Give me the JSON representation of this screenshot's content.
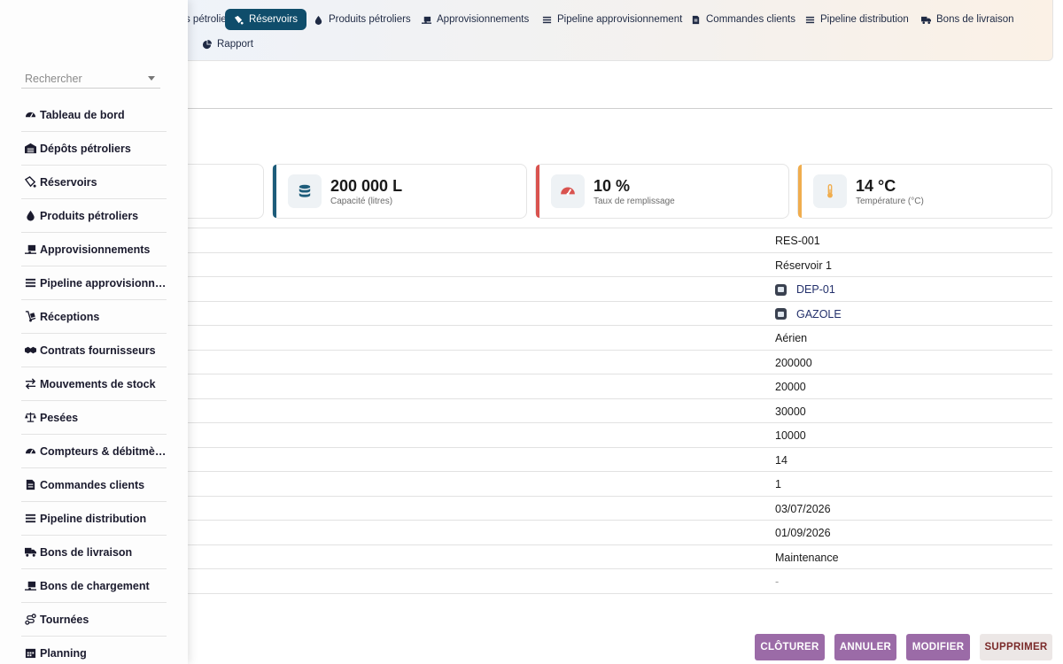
{
  "topnav": {
    "items": [
      {
        "label": "pôts pétroliers",
        "icon": "warehouse-icon"
      },
      {
        "label": "Réservoirs",
        "icon": "gas-pump-icon",
        "active": true
      },
      {
        "label": "Produits pétroliers",
        "icon": "droplet-icon"
      },
      {
        "label": "Approvisionnements",
        "icon": "truck-ramp-icon"
      },
      {
        "label": "Pipeline approvisionnement",
        "icon": "bars-icon"
      },
      {
        "label": "Commandes clients",
        "icon": "file-lines-icon"
      },
      {
        "label": "Pipeline distribution",
        "icon": "bars-icon"
      },
      {
        "label": "Bons de livraison",
        "icon": "truck-icon"
      },
      {
        "label": "Rapport",
        "icon": "chart-pie-icon"
      }
    ]
  },
  "sidebar": {
    "search_placeholder": "Rechercher",
    "items": [
      {
        "label": "Tableau de bord",
        "icon": "gauge-icon"
      },
      {
        "label": "Dépôts pétroliers",
        "icon": "warehouse-icon"
      },
      {
        "label": "Réservoirs",
        "icon": "gas-pump-icon"
      },
      {
        "label": "Produits pétroliers",
        "icon": "droplet-icon"
      },
      {
        "label": "Approvisionnements",
        "icon": "truck-ramp-icon"
      },
      {
        "label": "Pipeline approvisionnement",
        "icon": "bars-icon"
      },
      {
        "label": "Réceptions",
        "icon": "dolly-icon"
      },
      {
        "label": "Contrats fournisseurs",
        "icon": "handshake-icon"
      },
      {
        "label": "Mouvements de stock",
        "icon": "arrows-exchange-icon"
      },
      {
        "label": "Pesées",
        "icon": "scale-icon"
      },
      {
        "label": "Compteurs & débitmètres",
        "icon": "gauge-icon"
      },
      {
        "label": "Commandes clients",
        "icon": "file-lines-icon"
      },
      {
        "label": "Pipeline distribution",
        "icon": "bars-icon"
      },
      {
        "label": "Bons de livraison",
        "icon": "truck-icon"
      },
      {
        "label": "Bons de chargement",
        "icon": "truck-ramp-icon"
      },
      {
        "label": "Tournées",
        "icon": "route-icon"
      },
      {
        "label": "Planning",
        "icon": "calendar-icon"
      }
    ]
  },
  "cards": [
    {
      "value": "200 000 L",
      "label": "Capacité (litres)",
      "icon": "database-icon",
      "color": "#1d5c7a"
    },
    {
      "value": "10 %",
      "label": "Taux de remplissage",
      "icon": "gauge-icon",
      "color": "#d9534f"
    },
    {
      "value": "14 °C",
      "label": "Température (°C)",
      "icon": "thermometer-icon",
      "color": "#f0ad4e"
    }
  ],
  "details": [
    {
      "value": "RES-001"
    },
    {
      "value": "Réservoir 1"
    },
    {
      "value": "DEP-01",
      "link": true
    },
    {
      "value": "GAZOLE",
      "link": true
    },
    {
      "value": "Aérien"
    },
    {
      "value": "200000"
    },
    {
      "value": "20000"
    },
    {
      "value": "30000"
    },
    {
      "value": "10000"
    },
    {
      "value": "14"
    },
    {
      "value": "1"
    },
    {
      "value": "03/07/2026"
    },
    {
      "value": "01/09/2026"
    },
    {
      "value": "Maintenance"
    },
    {
      "value": "-",
      "muted": true
    }
  ],
  "actions": {
    "cloturer": "CLÔTURER",
    "annuler": "ANNULER",
    "modifier": "MODIFIER",
    "supprimer": "SUPPRIMER"
  }
}
